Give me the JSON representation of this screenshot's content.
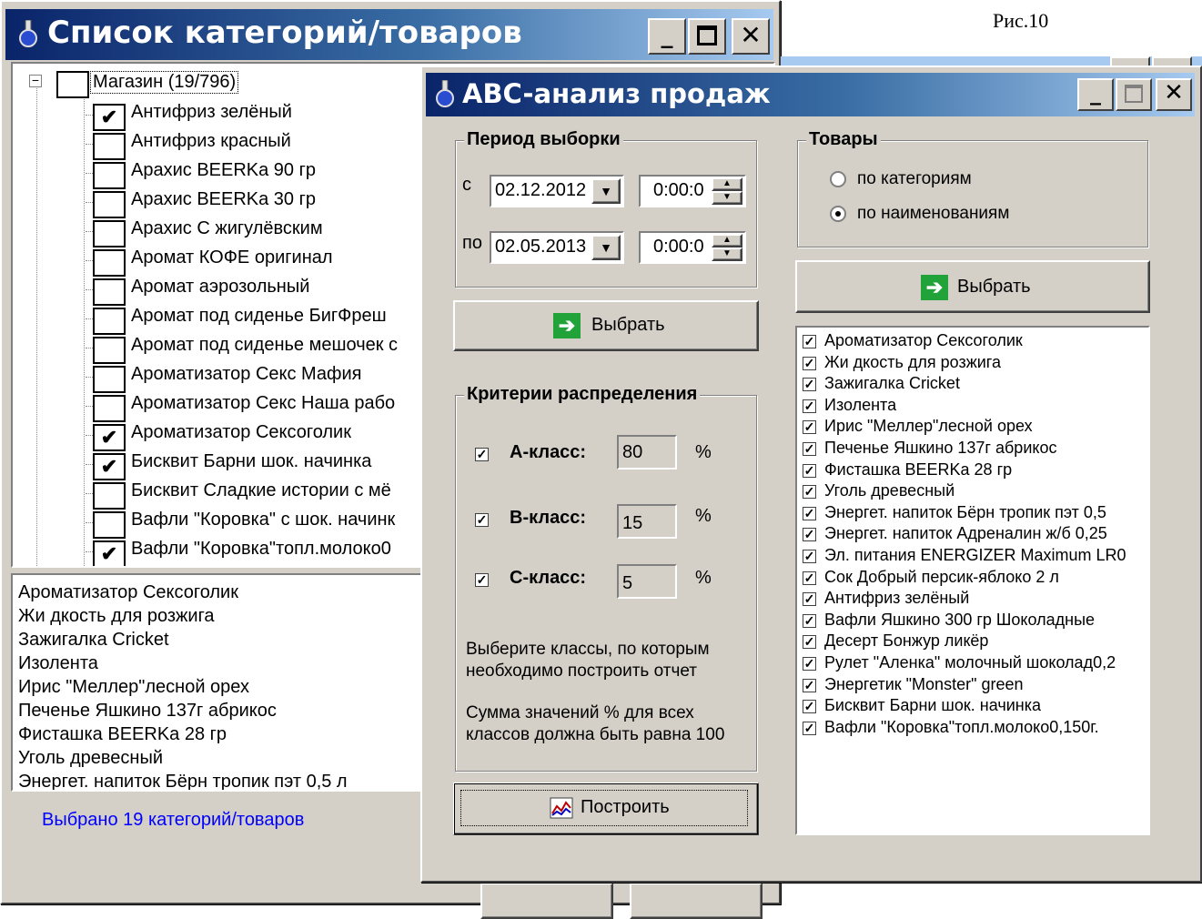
{
  "figure_caption": "Рис.10",
  "back_window": {
    "title": "Список категорий/товаров",
    "tree_root": "Магазин (19/796)",
    "tree_items": [
      {
        "label": "Антифриз зелёный",
        "checked": true
      },
      {
        "label": "Антифриз красный",
        "checked": false
      },
      {
        "label": "Арахис BEERKa  90 гр",
        "checked": false
      },
      {
        "label": "Арахис BEERKa 30 гр",
        "checked": false
      },
      {
        "label": "Арахис С жигулёвским",
        "checked": false
      },
      {
        "label": "Аромат КОФЕ оригинал",
        "checked": false
      },
      {
        "label": "Аромат аэрозольный",
        "checked": false
      },
      {
        "label": "Аромат под сиденье БигФреш",
        "checked": false
      },
      {
        "label": "Аромат под сиденье мешочек с",
        "checked": false
      },
      {
        "label": "Ароматизатор Секс Мафия",
        "checked": false
      },
      {
        "label": "Ароматизатор Секс Наша рабо",
        "checked": false
      },
      {
        "label": "Ароматизатор Сексоголик",
        "checked": true
      },
      {
        "label": "Бисквит Барни шок. начинка",
        "checked": true
      },
      {
        "label": "Бисквит Сладкие истории с мё",
        "checked": false
      },
      {
        "label": "Вафли \"Коровка\" с шок. начинк",
        "checked": false
      },
      {
        "label": "Вафли \"Коровка\"топл.молоко0",
        "checked": true
      }
    ],
    "selected_list": [
      "Ароматизатор Сексоголик",
      "Жи дкость для розжига",
      "Зажигалка Cricket",
      "Изолента",
      "Ирис \"Меллер\"лесной орех",
      "Печенье Яшкино 137г абрикос",
      "Фисташка BEERKa  28 гр",
      "Уголь древесный",
      "Энергет. напиток Бёрн тропик пэт 0,5 л"
    ],
    "status": "Выбрано 19 категорий/товаров"
  },
  "front_window": {
    "title": "ABC-анализ продаж",
    "period": {
      "label": "Период выборки",
      "from_label": "с",
      "to_label": "по",
      "from_date": "02.12.2012",
      "to_date": "02.05.2013",
      "from_time": "0:00:0",
      "to_time": "0:00:0"
    },
    "select_button": "Выбрать",
    "criteria": {
      "label": "Критерии распределения",
      "classes": [
        {
          "name": "А-класс:",
          "value": "80",
          "checked": true,
          "unit": "%"
        },
        {
          "name": "В-класс:",
          "value": "15",
          "checked": true,
          "unit": "%"
        },
        {
          "name": "С-класс:",
          "value": "5",
          "checked": true,
          "unit": "%"
        }
      ],
      "hint1": "Выберите классы, по которым необходимо построить отчет",
      "hint2": "Сумма значений % для всех классов должна быть равна 100"
    },
    "build_button": "Построить",
    "goods": {
      "label": "Товары",
      "options": [
        {
          "label": "по категориям",
          "selected": false
        },
        {
          "label": "по наименованиям",
          "selected": true
        }
      ]
    },
    "goods_select_button": "Выбрать",
    "goods_list": [
      "Ароматизатор Сексоголик",
      "Жи дкость для розжига",
      "Зажигалка Cricket",
      "Изолента",
      "Ирис \"Меллер\"лесной орех",
      "Печенье Яшкино 137г абрикос",
      "Фисташка BEERKa  28 гр",
      "Уголь древесный",
      "Энергет. напиток Бёрн тропик пэт 0,5",
      "Энергет. напиток Адреналин ж/б 0,25",
      "Эл. питания ENERGIZER Maximum LR0",
      "Сок Добрый персик-яблоко 2 л",
      "Антифриз зелёный",
      "Вафли Яшкино 300 гр Шоколадные",
      "Десерт Бонжур ликёр",
      "Рулет \"Аленка\" молочный шоколад0,2",
      "Энергетик \"Monster\" green",
      "Бисквит Барни шок. начинка",
      "Вафли \"Коровка\"топл.молоко0,150г."
    ]
  },
  "colors": {
    "title_start": "#0a246a",
    "title_end": "#a6caf0",
    "status_text": "#0000ff",
    "arrow_green": "#22a33a"
  }
}
